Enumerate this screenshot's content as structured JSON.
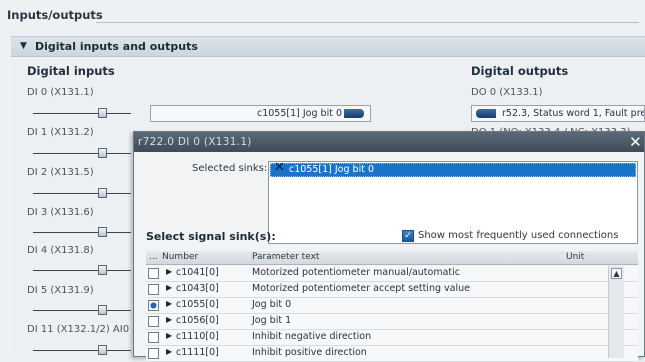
{
  "section": {
    "title": "Inputs/outputs"
  },
  "group": {
    "title": "Digital inputs and outputs"
  },
  "inputs": {
    "heading": "Digital inputs",
    "items": [
      {
        "label": "DI 0 (X131.1)",
        "value": "c1055[1] Jog bit 0"
      },
      {
        "label": "DI 1 (X131.2)",
        "value": ""
      },
      {
        "label": "DI 2 (X131.5)",
        "value": ""
      },
      {
        "label": "DI 3 (X131.6)",
        "value": ""
      },
      {
        "label": "DI 4 (X131.8)",
        "value": ""
      },
      {
        "label": "DI 5 (X131.9)",
        "value": ""
      },
      {
        "label": "DI 11 (X132.1/2) AI0",
        "value": ""
      }
    ]
  },
  "outputs": {
    "heading": "Digital outputs",
    "items": [
      {
        "label": "DO 0 (X133.1)",
        "value": "r52.3, Status word 1, Fault prese"
      },
      {
        "label": "DO 1 (NO: X133.4 / NC: X133.3)",
        "value": ""
      }
    ]
  },
  "dialog": {
    "title": "r722.0 DI 0 (X131.1)",
    "close_icon": "close-icon",
    "selected_sinks_label": "Selected sinks:",
    "selected_sinks": [
      "c1055[1] Jog bit 0"
    ],
    "select_heading": "Select signal sink(s):",
    "show_frequent_label": "Show most frequently used connections",
    "show_frequent_checked": true,
    "table": {
      "columns": [
        "...",
        "Number",
        "Parameter text",
        "Unit"
      ],
      "rows": [
        {
          "number": "c1041[0]",
          "text": "Motorized potentiometer manual/automatic",
          "checked": false
        },
        {
          "number": "c1043[0]",
          "text": "Motorized potentiometer accept setting value",
          "checked": false
        },
        {
          "number": "c1055[0]",
          "text": "Jog bit 0",
          "checked": true
        },
        {
          "number": "c1056[0]",
          "text": "Jog bit 1",
          "checked": false
        },
        {
          "number": "c1110[0]",
          "text": "Inhibit negative direction",
          "checked": false
        },
        {
          "number": "c1111[0]",
          "text": "Inhibit positive direction",
          "checked": false
        }
      ]
    }
  },
  "colors": {
    "accent": "#1a73c9",
    "connector": "#1f4c82"
  }
}
